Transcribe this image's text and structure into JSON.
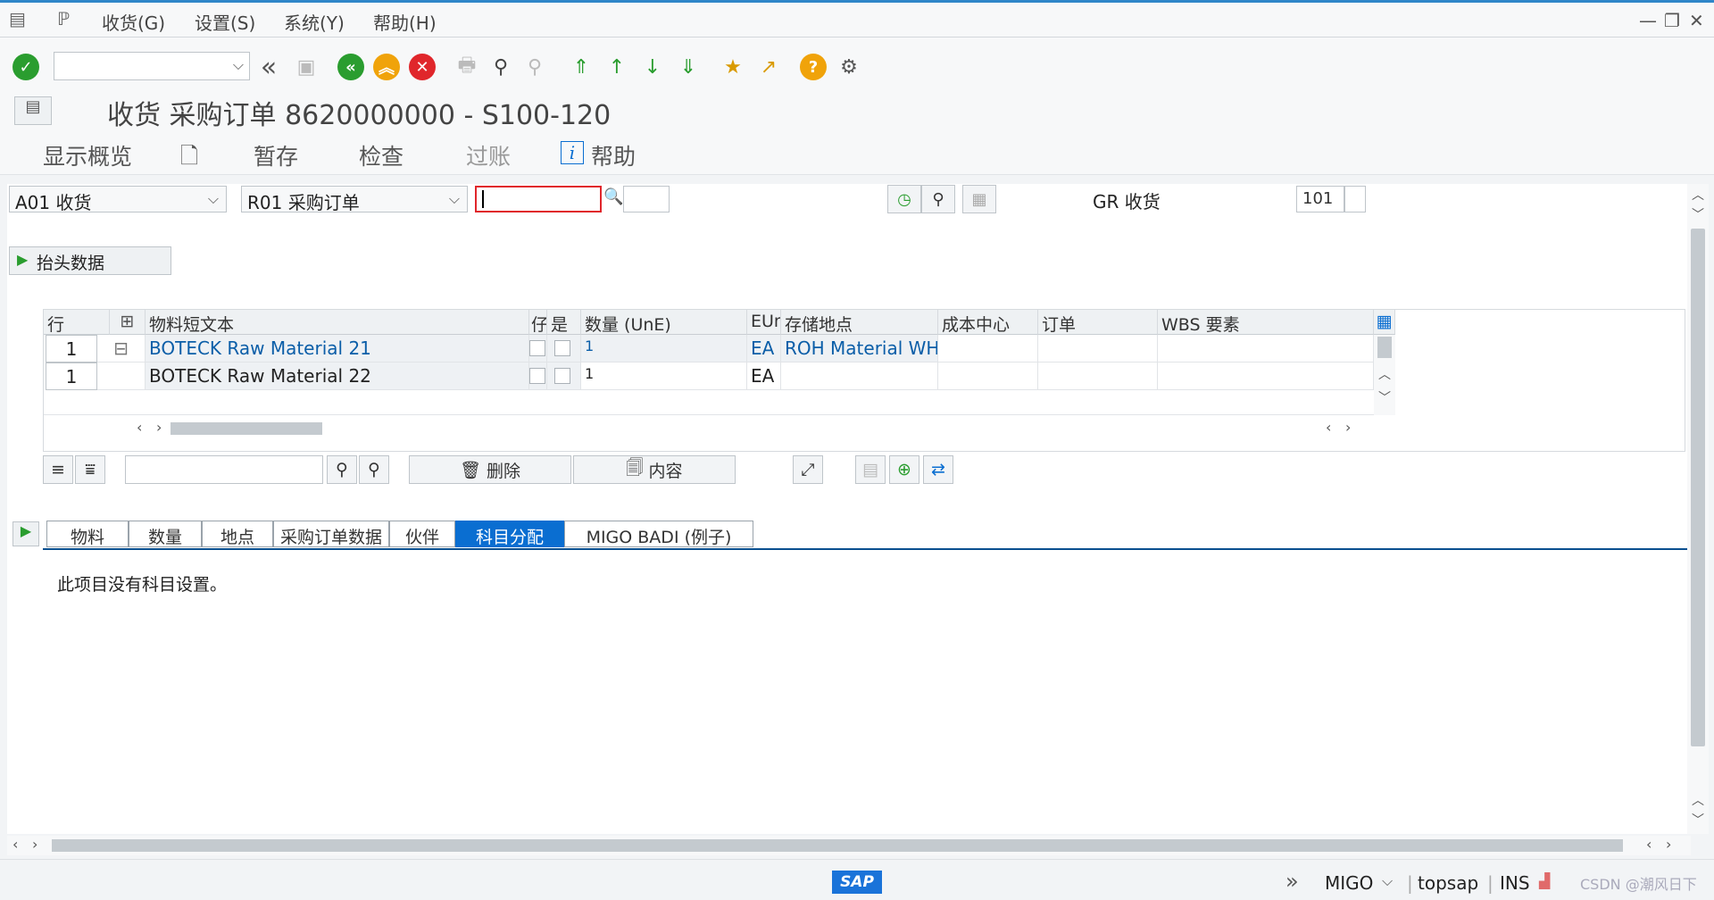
{
  "menu": {
    "items": [
      "收货(G)",
      "设置(S)",
      "系统(Y)",
      "帮助(H)"
    ]
  },
  "title": "收货 采购订单 8620000000 - S100-120",
  "app_toolbar": {
    "overview": "显示概览",
    "hold": "暂存",
    "check": "检查",
    "post": "过账",
    "help": "帮助"
  },
  "selection": {
    "action": "A01 收货",
    "reference": "R01 采购订单",
    "gr_label": "GR 收货",
    "movement_type": "101"
  },
  "header_data_label": "抬头数据",
  "grid": {
    "columns": [
      "行",
      "物料短文本",
      "仔",
      "是",
      "数量 (UnE)",
      "EUn",
      "存储地点",
      "成本中心",
      "订单",
      "WBS 要素"
    ],
    "rows": [
      {
        "line": "1",
        "text": "BOTECK Raw Material 21",
        "qty": "1",
        "unit": "EA",
        "sloc": "ROH Material WH"
      },
      {
        "line": "1",
        "text": "BOTECK Raw Material 22",
        "qty": "1",
        "unit": "EA",
        "sloc": ""
      }
    ]
  },
  "grid_toolbar": {
    "delete": "删除",
    "contents": "内容"
  },
  "tabs": [
    "物料",
    "数量",
    "地点",
    "采购订单数据",
    "伙伴",
    "科目分配",
    "MIGO BADI (例子)"
  ],
  "active_tab": "科目分配",
  "tab_message": "此项目没有科目设置。",
  "status": {
    "transaction": "MIGO",
    "user": "topsap",
    "mode": "INS",
    "watermark": "CSDN @潮风日下"
  },
  "colors": {
    "accent": "#0a6ed1",
    "ok": "#2a9d2f",
    "back": "#2a9d2f",
    "exit": "#f0a30a",
    "cancel": "#e0262b",
    "help": "#f0a30a"
  }
}
